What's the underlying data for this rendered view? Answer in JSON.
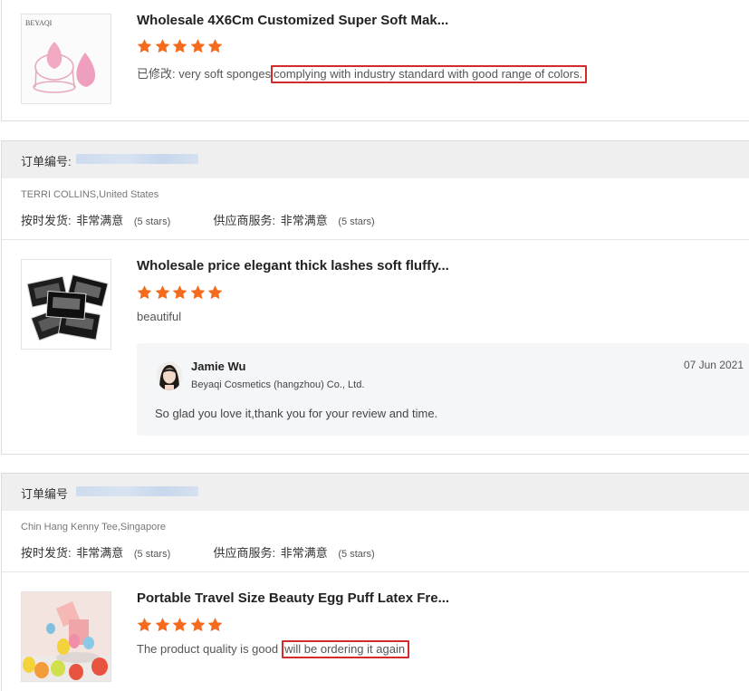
{
  "colors": {
    "star": "#f56a1d",
    "highlight_border": "#d12b2b",
    "order_bar": "#efefef"
  },
  "reviews": [
    {
      "product_title": "Wholesale 4X6Cm Customized Super Soft Mak...",
      "stars": 5,
      "review_prefix": "已修改: very soft sponges",
      "review_highlight": "complying with industry standard with good range of colors.",
      "thumb_brand": "BEYAQI"
    },
    {
      "order_label": "订单编号:",
      "buyer": "TERRI COLLINS,United States",
      "ratings": [
        {
          "key": "按时发货:",
          "value": "非常满意",
          "stars_text": "(5 stars)"
        },
        {
          "key": "供应商服务:",
          "value": "非常满意",
          "stars_text": "(5 stars)"
        }
      ],
      "product_title": "Wholesale price elegant thick lashes soft fluffy...",
      "stars": 5,
      "review_text": "beautiful",
      "reply": {
        "name": "Jamie Wu",
        "company": "Beyaqi Cosmetics (hangzhou) Co., Ltd.",
        "date": "07 Jun 2021",
        "text": "So glad you love it,thank you for your review and time."
      }
    },
    {
      "order_label": "订单编号",
      "buyer": "Chin Hang Kenny Tee,Singapore",
      "ratings": [
        {
          "key": "按时发货:",
          "value": "非常满意",
          "stars_text": "(5 stars)"
        },
        {
          "key": "供应商服务:",
          "value": "非常满意",
          "stars_text": "(5 stars)"
        }
      ],
      "product_title": "Portable Travel Size Beauty Egg Puff Latex Fre...",
      "stars": 5,
      "review_prefix": "The product quality is good",
      "review_highlight": "will be ordering it again"
    }
  ]
}
